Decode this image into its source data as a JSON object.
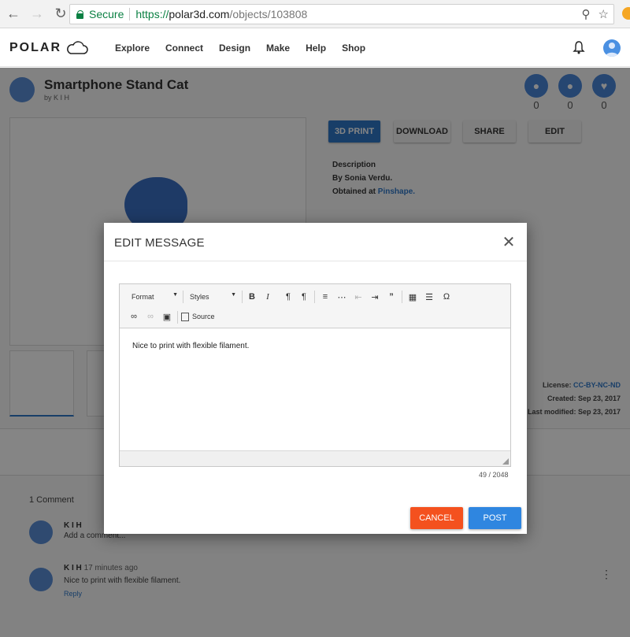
{
  "browser": {
    "secure_label": "Secure",
    "url_scheme": "https://",
    "url_host": "polar3d.com",
    "url_path": "/objects/103808",
    "back_icon": "back-arrow-icon",
    "forward_icon": "forward-arrow-icon",
    "reload_icon": "reload-icon"
  },
  "header": {
    "logo_text": "POLAR",
    "nav": [
      "Explore",
      "Connect",
      "Design",
      "Make",
      "Help",
      "Shop"
    ]
  },
  "object": {
    "title": "Smartphone Stand Cat",
    "by": "by K I H",
    "stats": [
      "0",
      "0",
      "0"
    ],
    "actions": [
      "3D PRINT",
      "DOWNLOAD",
      "SHARE",
      "EDIT"
    ],
    "description_heading": "Description",
    "description_line1": "By Sonia Verdu.",
    "description_line2_prefix": "Obtained at ",
    "description_line2_link": "Pinshape.",
    "license_label": "License: ",
    "license_value": "CC-BY-NC-ND",
    "created": "Created: Sep 23, 2017",
    "modified": "Last modified: Sep 23, 2017"
  },
  "comments": {
    "count": "1 Comment",
    "composer_name": "K I H",
    "composer_placeholder": "Add a comment...",
    "items": [
      {
        "name": "K I H",
        "time": "17 minutes ago",
        "text": "Nice to print with flexible filament.",
        "reply": "Reply"
      }
    ]
  },
  "modal": {
    "title": "EDIT MESSAGE",
    "toolbar": {
      "format_label": "Format",
      "styles_label": "Styles",
      "source_label": "Source"
    },
    "content": "Nice to print with flexible filament.",
    "char_count": "49 / 2048",
    "cancel_label": "CANCEL",
    "post_label": "POST"
  },
  "colors": {
    "primary": "#2f86e0",
    "cancel": "#f4511e",
    "secure": "#0b8043"
  }
}
